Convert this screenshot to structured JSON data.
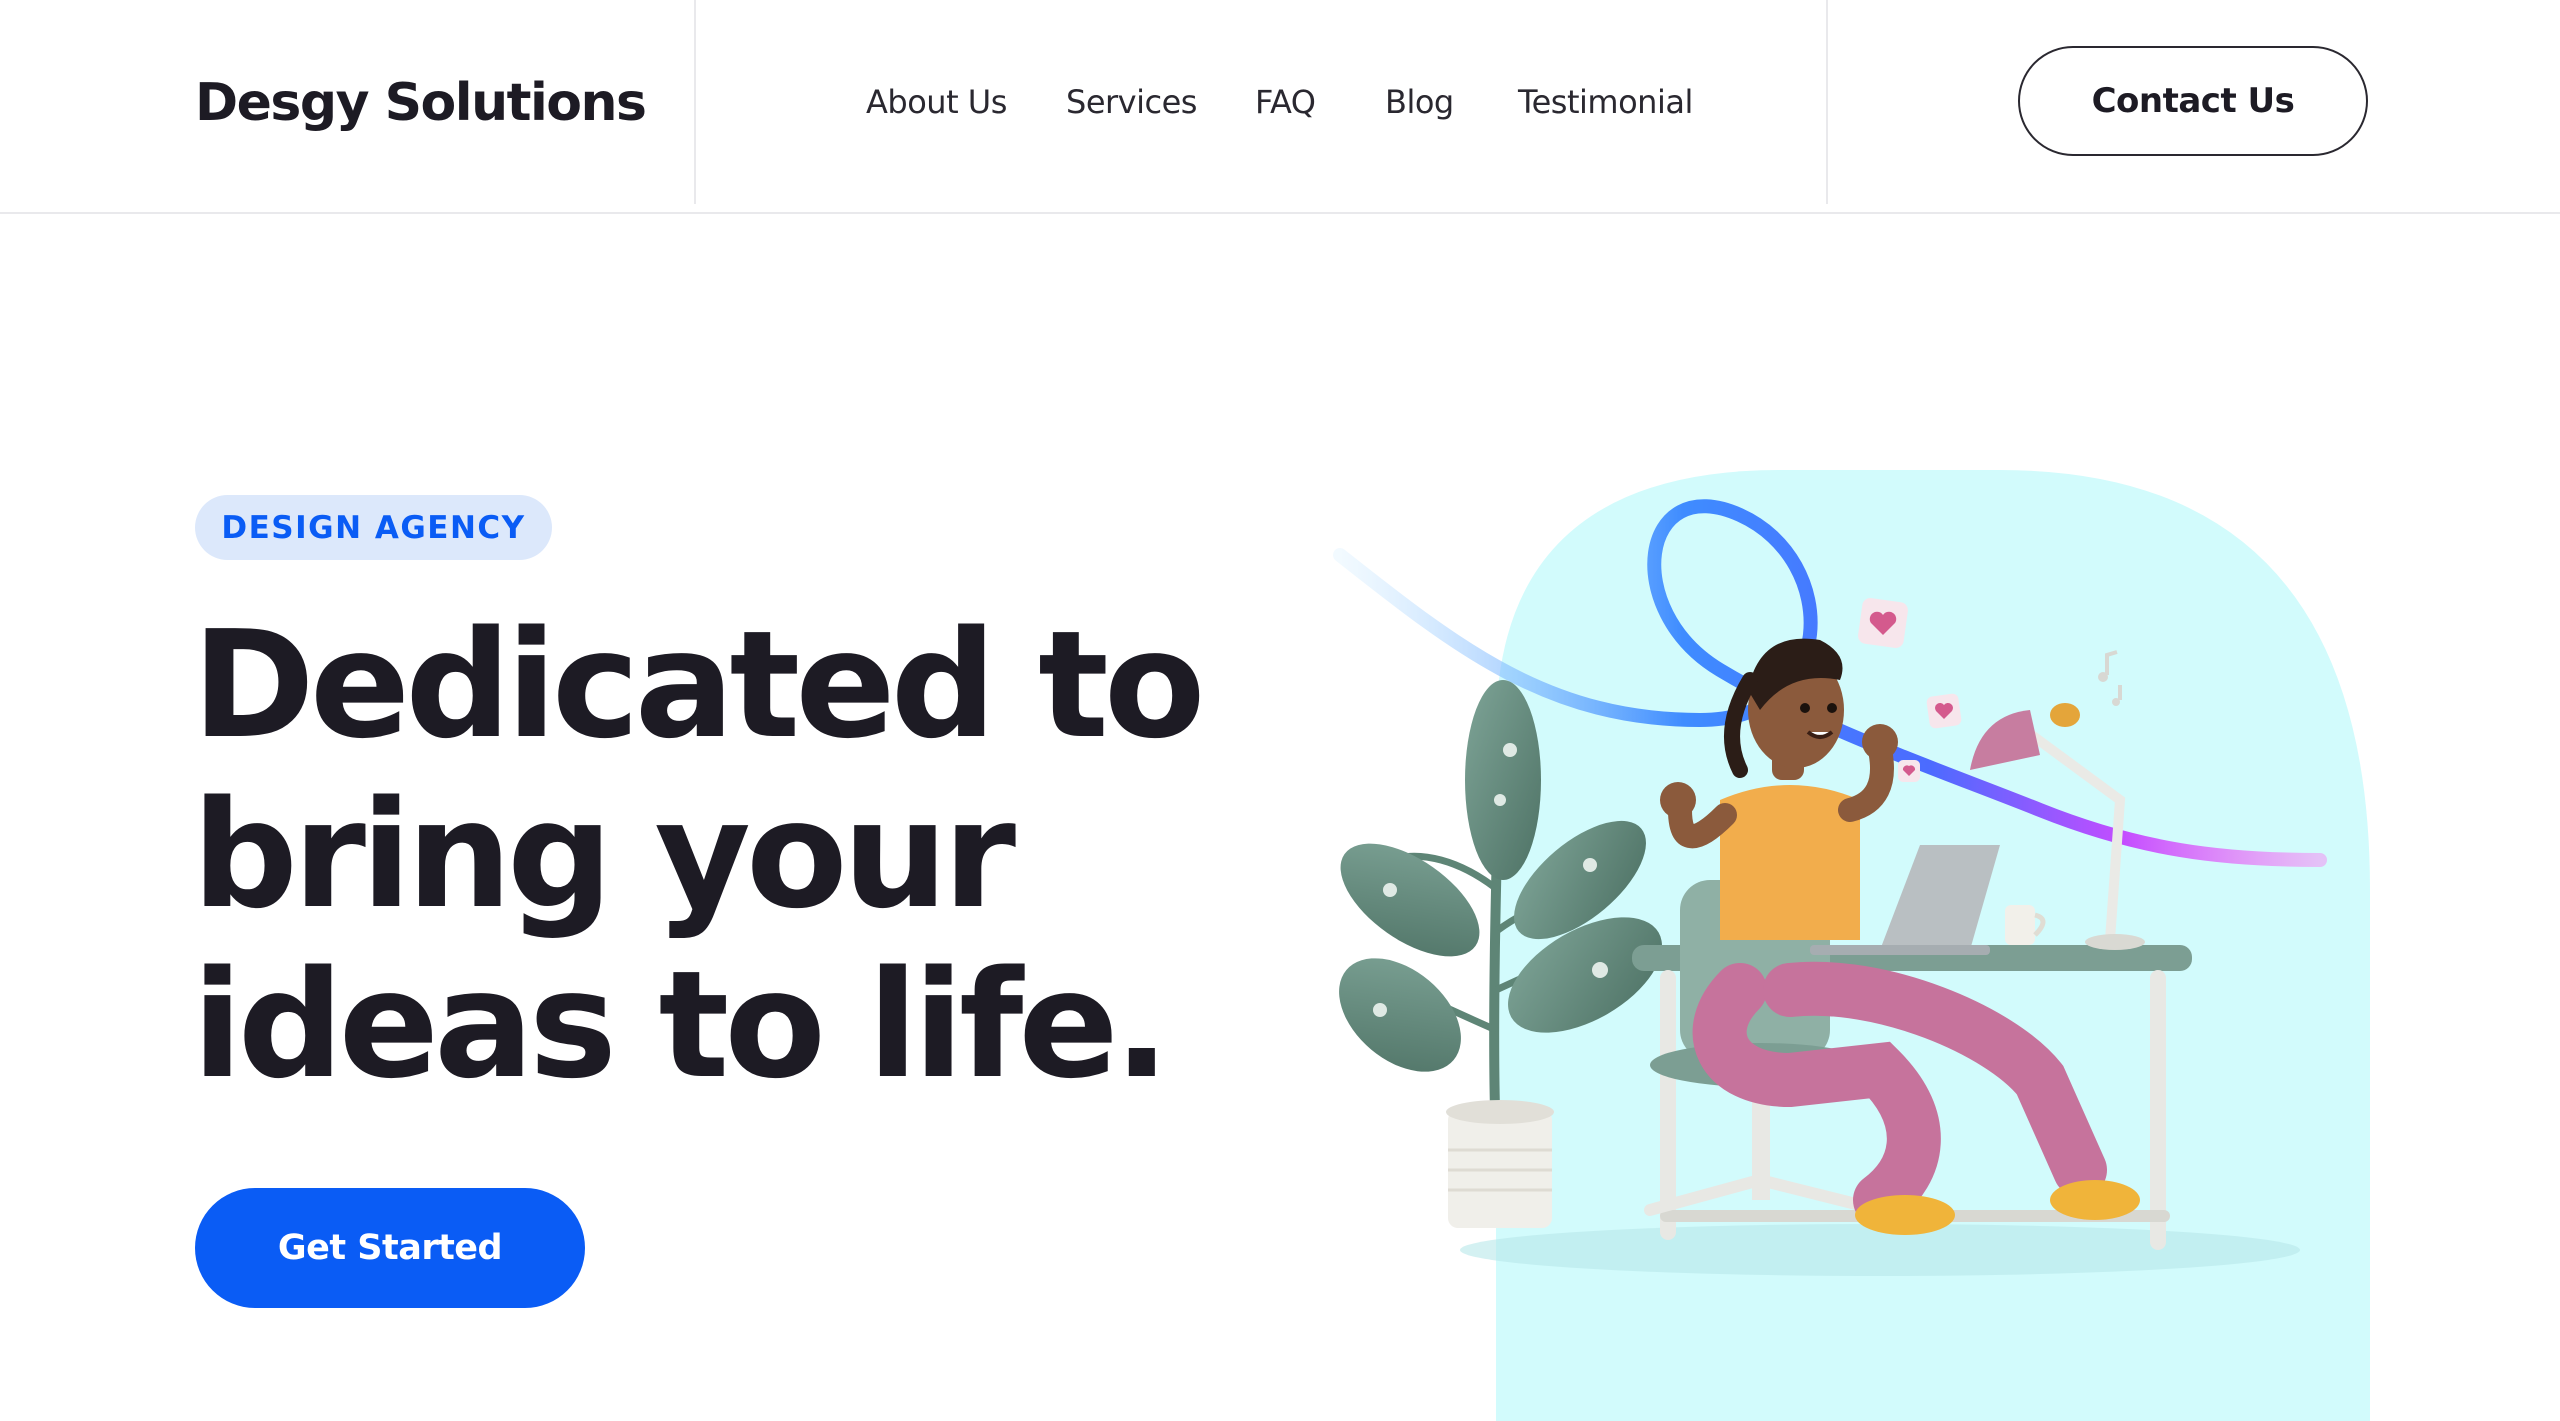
{
  "brand": {
    "name": "Desgy Solutions"
  },
  "nav": {
    "items": [
      {
        "label": "About Us"
      },
      {
        "label": "Services"
      },
      {
        "label": "FAQ"
      },
      {
        "label": "Blog"
      },
      {
        "label": "Testimonial"
      }
    ]
  },
  "header": {
    "contact_label": "Contact Us"
  },
  "hero": {
    "badge": "DESIGN AGENCY",
    "headline_lines": [
      "Dedicated to",
      "bring your",
      "ideas to life."
    ],
    "cta_label": "Get Started"
  },
  "illustration": {
    "icon": "person-at-desk-illustration"
  },
  "colors": {
    "accent": "#0A5CF5",
    "badge_bg": "#DCE8FB",
    "text": "#1D1B24",
    "illustration_bg": "#D2FBFC"
  }
}
